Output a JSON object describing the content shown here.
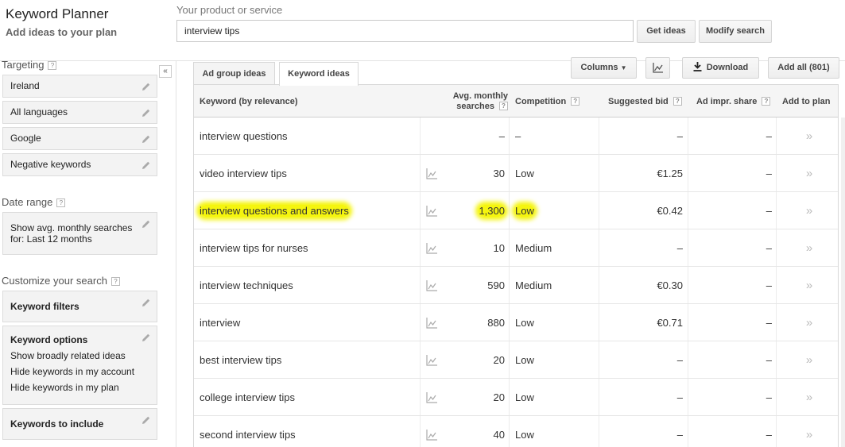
{
  "header": {
    "title": "Keyword Planner",
    "subtitle": "Add ideas to your plan",
    "product_label": "Your product or service",
    "search_value": "interview tips",
    "get_ideas": "Get ideas",
    "modify_search": "Modify search"
  },
  "sidebar": {
    "targeting_label": "Targeting",
    "targeting": [
      "Ireland",
      "All languages",
      "Google",
      "Negative keywords"
    ],
    "date_range_label": "Date range",
    "date_range_value": "Show avg. monthly searches for: Last 12 months",
    "customize_label": "Customize your search",
    "keyword_filters": "Keyword filters",
    "keyword_options_title": "Keyword options",
    "keyword_options": [
      "Show broadly related ideas",
      "Hide keywords in my account",
      "Hide keywords in my plan"
    ],
    "keywords_to_include": "Keywords to include"
  },
  "tabs": {
    "ad_group": "Ad group ideas",
    "keyword": "Keyword ideas"
  },
  "toolbar": {
    "columns": "Columns",
    "download": "Download",
    "add_all": "Add all (801)"
  },
  "table": {
    "headers": {
      "keyword": "Keyword (by relevance)",
      "searches_1": "Avg. monthly",
      "searches_2": "searches",
      "competition": "Competition",
      "bid": "Suggested bid",
      "impr": "Ad impr. share",
      "add": "Add to plan"
    },
    "rows": [
      {
        "keyword": "interview questions",
        "searches": "–",
        "competition": "–",
        "bid": "–",
        "impr": "–",
        "trend": false,
        "highlight": false
      },
      {
        "keyword": "video interview tips",
        "searches": "30",
        "competition": "Low",
        "bid": "€1.25",
        "impr": "–",
        "trend": true,
        "highlight": false
      },
      {
        "keyword": "interview questions and answers",
        "searches": "1,300",
        "competition": "Low",
        "bid": "€0.42",
        "impr": "–",
        "trend": true,
        "highlight": true
      },
      {
        "keyword": "interview tips for nurses",
        "searches": "10",
        "competition": "Medium",
        "bid": "–",
        "impr": "–",
        "trend": true,
        "highlight": false
      },
      {
        "keyword": "interview techniques",
        "searches": "590",
        "competition": "Medium",
        "bid": "€0.30",
        "impr": "–",
        "trend": true,
        "highlight": false
      },
      {
        "keyword": "interview",
        "searches": "880",
        "competition": "Low",
        "bid": "€0.71",
        "impr": "–",
        "trend": true,
        "highlight": false
      },
      {
        "keyword": "best interview tips",
        "searches": "20",
        "competition": "Low",
        "bid": "–",
        "impr": "–",
        "trend": true,
        "highlight": false
      },
      {
        "keyword": "college interview tips",
        "searches": "20",
        "competition": "Low",
        "bid": "–",
        "impr": "–",
        "trend": true,
        "highlight": false
      },
      {
        "keyword": "second interview tips",
        "searches": "40",
        "competition": "Low",
        "bid": "–",
        "impr": "–",
        "trend": true,
        "highlight": false
      }
    ]
  },
  "icons": {
    "edit": "pencil-icon",
    "trend": "trend-chart-icon",
    "add": "add-to-plan-icon",
    "download": "download-icon",
    "collapse": "collapse-icon"
  },
  "colors": {
    "highlight": "#f5f50e"
  }
}
